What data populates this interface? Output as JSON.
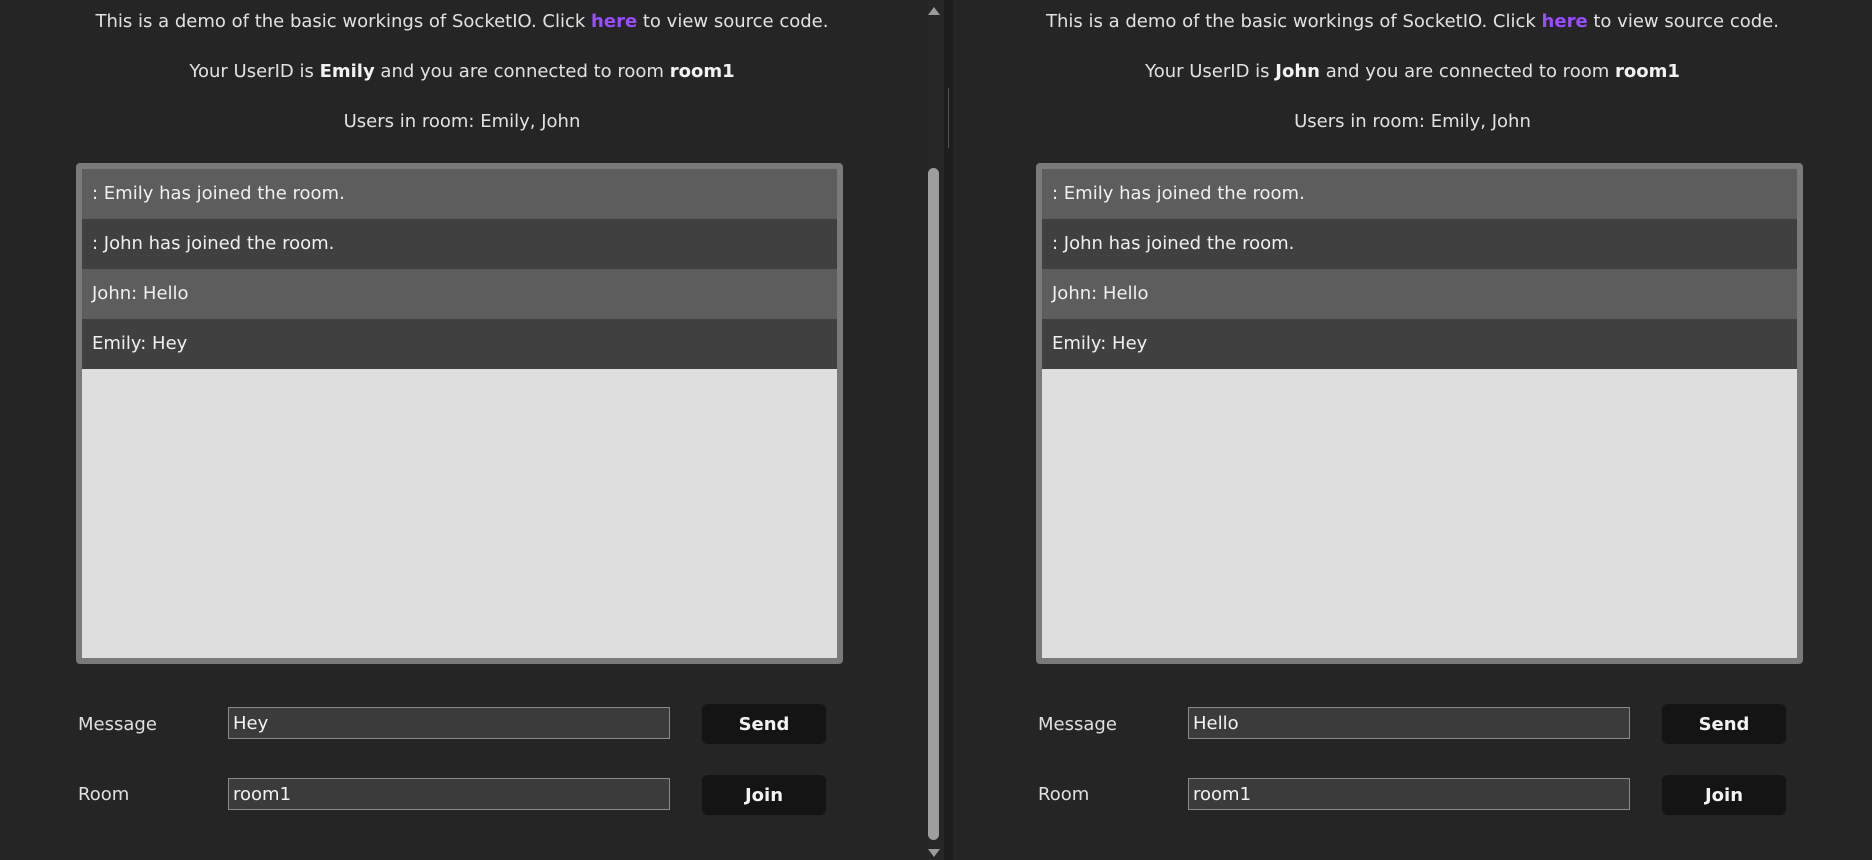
{
  "colors": {
    "link": "#9a4cff",
    "background": "#252525",
    "chat_area": "#dedede",
    "message_row_light": "#5d5d5d",
    "message_row_dark": "#404040",
    "button": "#141414"
  },
  "left": {
    "intro_before": "This is a demo of the basic workings of SocketIO. Click ",
    "intro_link": "here",
    "intro_after": " to view source code.",
    "userid_prefix": "Your UserID is ",
    "user_id": "Emily",
    "room_prefix": " and you are connected to room ",
    "room_name": "room1",
    "users_in_room": "Users in room: Emily, John",
    "messages": [
      ": Emily has joined the room.",
      ": John has joined the room.",
      "John: Hello",
      "Emily: Hey"
    ],
    "message_label": "Message",
    "message_value": "Hey",
    "send_label": "Send",
    "room_label": "Room",
    "room_value": "room1",
    "join_label": "Join"
  },
  "right": {
    "intro_before": "This is a demo of the basic workings of SocketIO. Click ",
    "intro_link": "here",
    "intro_after": " to view source code.",
    "userid_prefix": "Your UserID is ",
    "user_id": "John",
    "room_prefix": " and you are connected to room ",
    "room_name": "room1",
    "users_in_room": "Users in room: Emily, John",
    "messages": [
      ": Emily has joined the room.",
      ": John has joined the room.",
      "John: Hello",
      "Emily: Hey"
    ],
    "message_label": "Message",
    "message_value": "Hello",
    "send_label": "Send",
    "room_label": "Room",
    "room_value": "room1",
    "join_label": "Join"
  }
}
